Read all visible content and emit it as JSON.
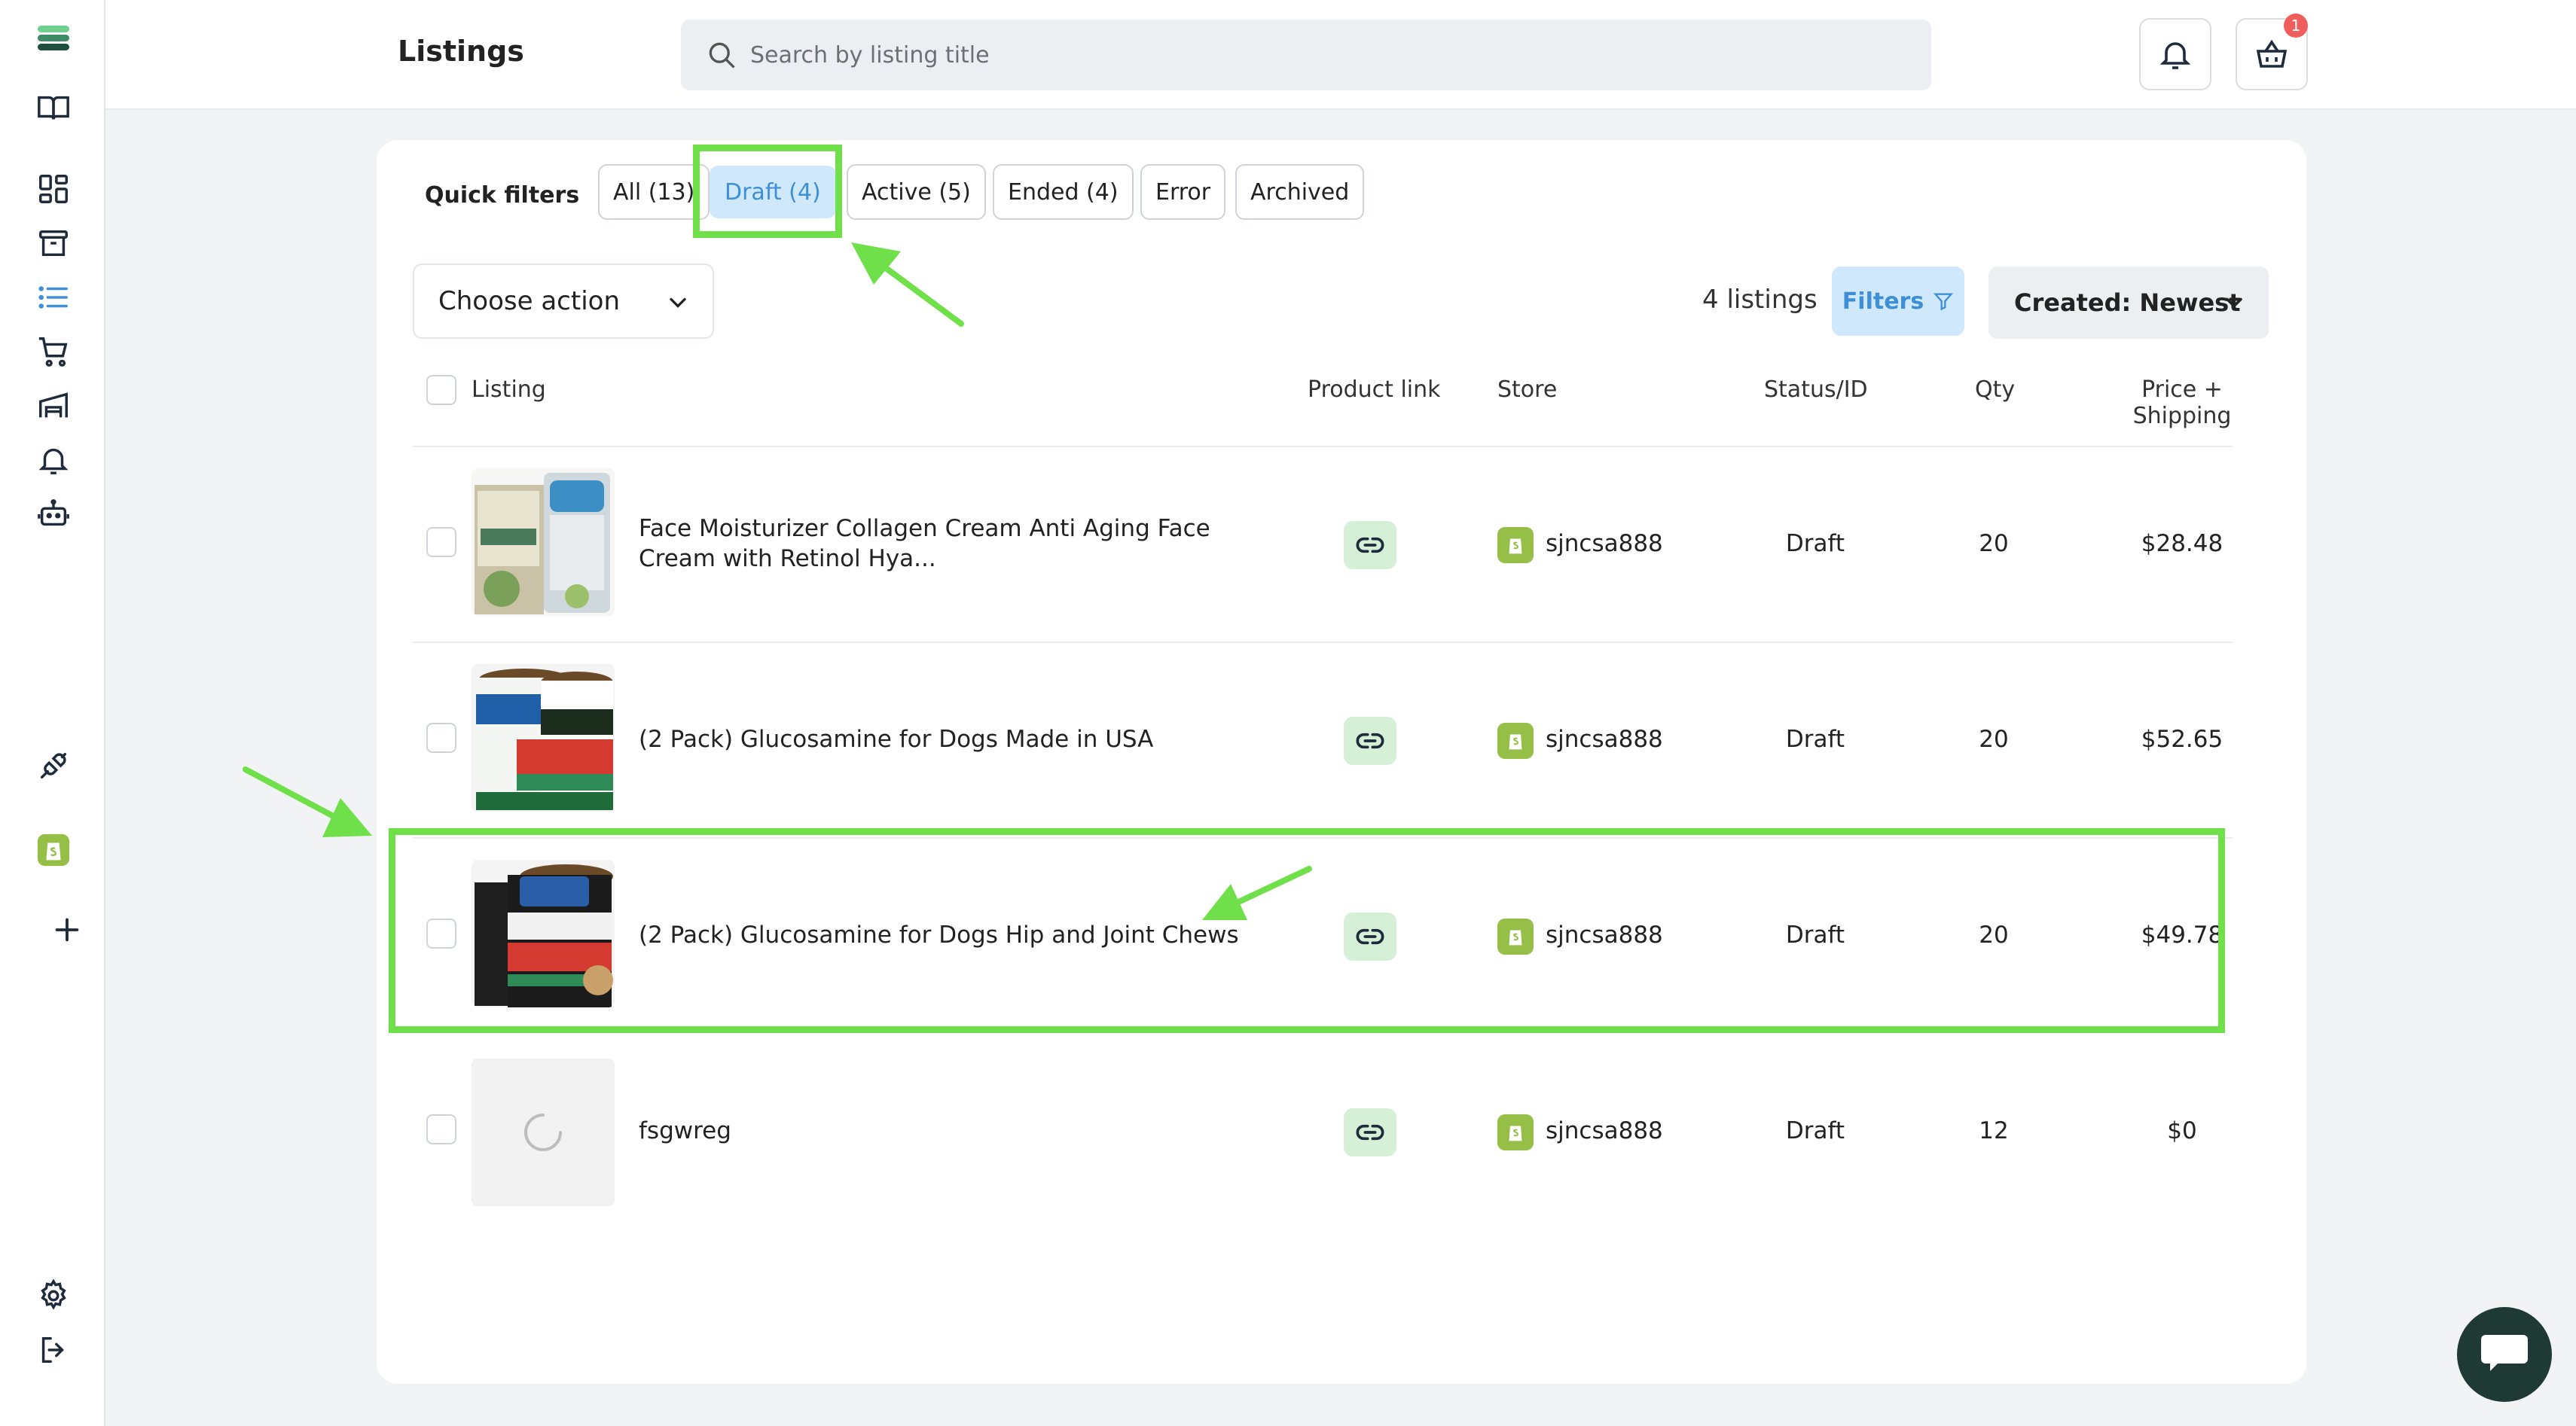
{
  "header": {
    "title": "Listings",
    "search_placeholder": "Search by listing title",
    "cart_badge": "1"
  },
  "quick_filters": {
    "label": "Quick filters",
    "chips": [
      {
        "label": "All (13)",
        "active": false
      },
      {
        "label": "Draft (4)",
        "active": true
      },
      {
        "label": "Active (5)",
        "active": false
      },
      {
        "label": "Ended (4)",
        "active": false
      },
      {
        "label": "Error",
        "active": false
      },
      {
        "label": "Archived",
        "active": false
      }
    ]
  },
  "toolbar": {
    "choose_action": "Choose action",
    "count": "4 listings",
    "filters": "Filters",
    "sort": "Created: Newest"
  },
  "table": {
    "headers": {
      "listing": "Listing",
      "product_link": "Product link",
      "store": "Store",
      "status": "Status/ID",
      "qty": "Qty",
      "price_line1": "Price +",
      "price_line2": "Shipping"
    },
    "rows": [
      {
        "title": "Face Moisturizer Collagen Cream Anti Aging Face Cream with Retinol Hya...",
        "store": "sjncsa888",
        "status": "Draft",
        "qty": "20",
        "price": "$28.48",
        "image": "cream"
      },
      {
        "title": "(2 Pack) Glucosamine for Dogs Made in USA",
        "store": "sjncsa888",
        "status": "Draft",
        "qty": "20",
        "price": "$52.65",
        "image": "glucosamine-white"
      },
      {
        "title": "(2 Pack) Glucosamine for Dogs Hip and Joint Chews",
        "store": "sjncsa888",
        "status": "Draft",
        "qty": "20",
        "price": "$49.78",
        "image": "glucosamine-dark"
      },
      {
        "title": "fsgwreg",
        "store": "sjncsa888",
        "status": "Draft",
        "qty": "12",
        "price": "$0",
        "image": "loading"
      }
    ]
  },
  "colors": {
    "accent_blue": "#3f8fd6",
    "active_chip_bg": "#cfe8fb",
    "annotation_green": "#6fe04a",
    "shopify_green": "#95bf47"
  }
}
